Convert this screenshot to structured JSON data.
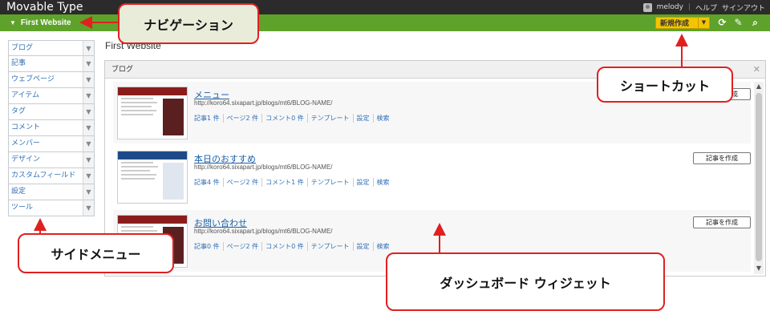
{
  "topbar": {
    "app_title": "Movable Type",
    "user": "melody",
    "help": "ヘルプ",
    "signout": "サインアウト"
  },
  "navbar": {
    "site_name": "First Website",
    "new_button": "新規作成",
    "icons": [
      "refresh-icon",
      "edit-icon",
      "search-icon"
    ]
  },
  "sidebar": {
    "items": [
      {
        "label": "ブログ"
      },
      {
        "label": "記事"
      },
      {
        "label": "ウェブページ"
      },
      {
        "label": "アイテム"
      },
      {
        "label": "タグ"
      },
      {
        "label": "コメント"
      },
      {
        "label": "メンバー"
      },
      {
        "label": "デザイン"
      },
      {
        "label": "カスタムフィールド"
      },
      {
        "label": "設定"
      },
      {
        "label": "ツール"
      }
    ]
  },
  "main": {
    "page_title": "First Website",
    "widget_title": "ブログ",
    "blogs": [
      {
        "name": "メニュー",
        "url": "http://koro64.sixapart.jp/blogs/mt6/BLOG-NAME/",
        "links": [
          "記事1 件",
          "ページ2 件",
          "コメント0 件",
          "テンプレート",
          "設定",
          "検索"
        ],
        "create": "記事を作成",
        "theme_color": "#8b1c1c"
      },
      {
        "name": "本日のおすすめ",
        "url": "http://koro64.sixapart.jp/blogs/mt6/BLOG-NAME/",
        "links": [
          "記事4 件",
          "ページ2 件",
          "コメント1 件",
          "テンプレート",
          "設定",
          "検索"
        ],
        "create": "記事を作成",
        "theme_color": "#1e4a8a"
      },
      {
        "name": "お問い合わせ",
        "url": "http://koro64.sixapart.jp/blogs/mt6/BLOG-NAME/",
        "links": [
          "記事0 件",
          "ページ2 件",
          "コメント0 件",
          "テンプレート",
          "設定",
          "検索"
        ],
        "create": "記事を作成",
        "theme_color": "#8b1c1c"
      }
    ]
  },
  "callouts": {
    "nav": "ナビゲーション",
    "shortcut": "ショートカット",
    "side_menu": "サイドメニュー",
    "dashboard": "ダッシュボード ウィジェット"
  },
  "colors": {
    "navbar": "#5ea22b",
    "new_button": "#f5c400",
    "callout_border": "#e02020"
  }
}
